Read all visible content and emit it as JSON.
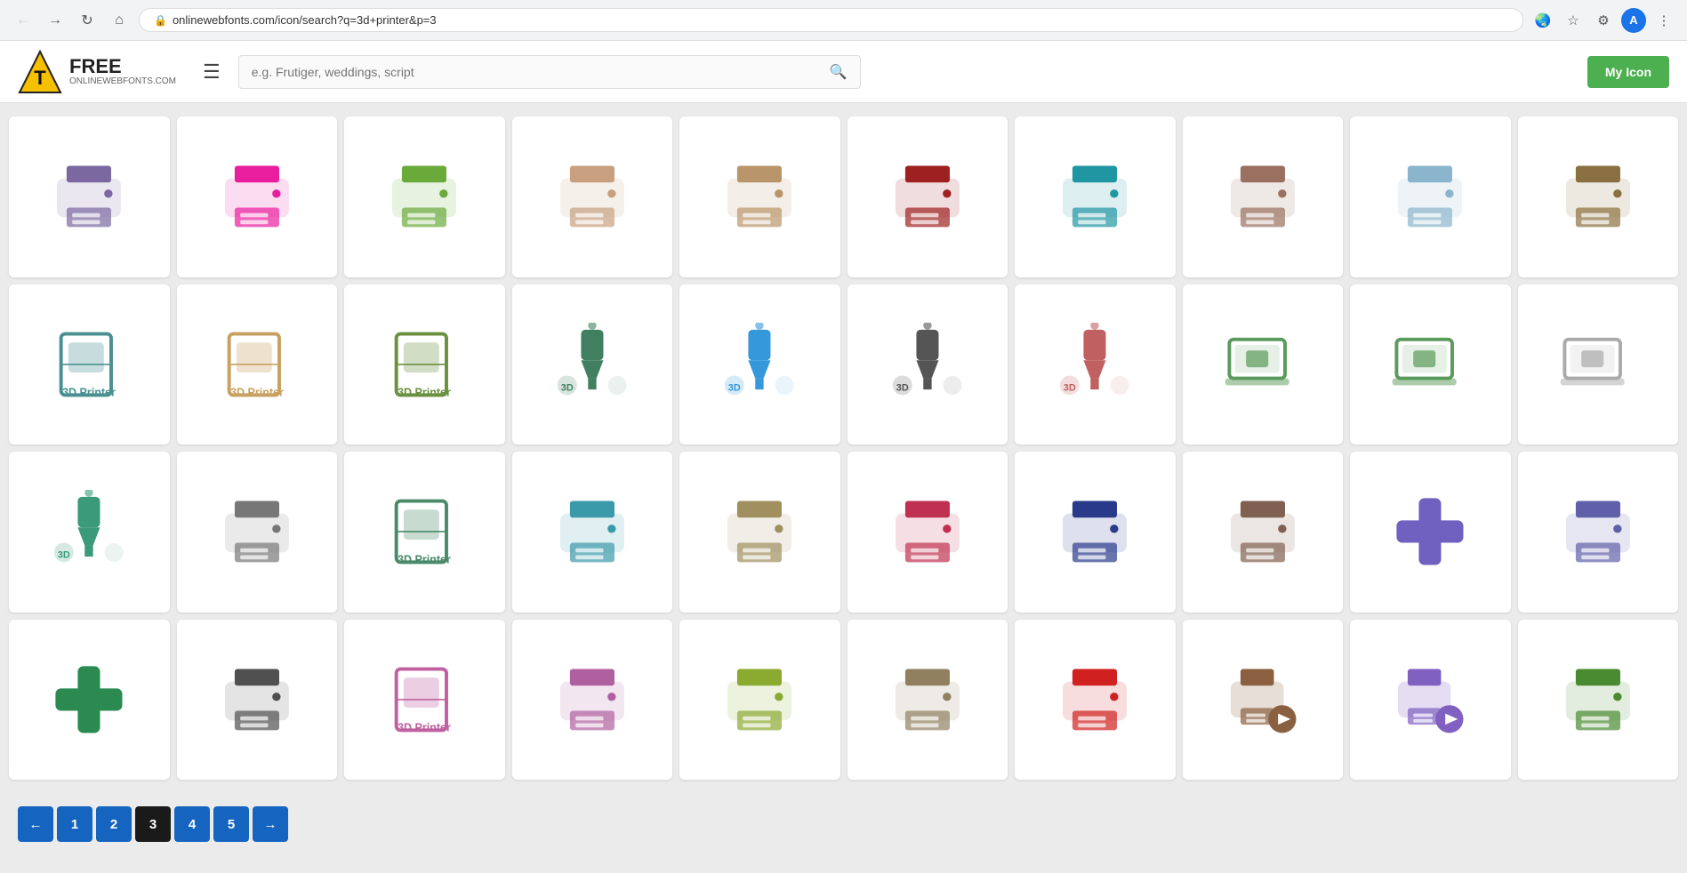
{
  "browser": {
    "url": "onlinewebfonts.com/icon/search?q=3d+printer&p=3",
    "avatar_letter": "A"
  },
  "header": {
    "logo_letter": "T",
    "logo_text": "FREE",
    "logo_sub": "ONLINEWEBFONTS.COM",
    "search_placeholder": "e.g. Frutiger, weddings, script",
    "my_icon_label": "My Icon"
  },
  "pagination": {
    "prev_label": "←",
    "next_label": "→",
    "pages": [
      "1",
      "2",
      "3",
      "4",
      "5"
    ],
    "active_page": "3"
  },
  "icons": [
    {
      "id": "r1c1",
      "color": "#7b68a0",
      "desc": "printer-purple-outline"
    },
    {
      "id": "r1c2",
      "color": "#e91e9e",
      "desc": "printer-pink"
    },
    {
      "id": "r1c3",
      "color": "#6aaa3a",
      "desc": "printer-green"
    },
    {
      "id": "r1c4",
      "color": "#c8a080",
      "desc": "printer-tan-outline"
    },
    {
      "id": "r1c5",
      "color": "#b8956a",
      "desc": "printer-brown-outline"
    },
    {
      "id": "r1c6",
      "color": "#9e2020",
      "desc": "printer-dark-red-circle"
    },
    {
      "id": "r1c7",
      "color": "#2196a3",
      "desc": "printer-teal"
    },
    {
      "id": "r1c8",
      "color": "#9a7060",
      "desc": "printer-taupe"
    },
    {
      "id": "r1c9",
      "color": "#8ab5cc",
      "desc": "printer-blue-light"
    },
    {
      "id": "r1c10",
      "color": "#8a7040",
      "desc": "printer-khaki"
    },
    {
      "id": "r2c1",
      "color": "#4a9090",
      "desc": "3d-box-teal"
    },
    {
      "id": "r2c2",
      "color": "#c8a060",
      "desc": "3d-box-tan"
    },
    {
      "id": "r2c3",
      "color": "#6a9040",
      "desc": "3d-box-green"
    },
    {
      "id": "r2c4",
      "color": "#408060",
      "desc": "3d-printer-car-teal"
    },
    {
      "id": "r2c5",
      "color": "#3498db",
      "desc": "3d-printer-nozzle-blue"
    },
    {
      "id": "r2c6",
      "color": "#555",
      "desc": "3d-printer-nozzle-dark"
    },
    {
      "id": "r2c7",
      "color": "#c06060",
      "desc": "3d-printer-nozzle-pink"
    },
    {
      "id": "r2c8",
      "color": "#5a9a5a",
      "desc": "laptop-3d-green"
    },
    {
      "id": "r2c9",
      "color": "#5a9a5a",
      "desc": "laptop-3d-green2"
    },
    {
      "id": "r2c10",
      "color": "#aaa",
      "desc": "laptop-3d-gray"
    },
    {
      "id": "r3c1",
      "color": "#3a9a7a",
      "desc": "3d-printer-teal"
    },
    {
      "id": "r3c2",
      "color": "#777",
      "desc": "3d-person-gray"
    },
    {
      "id": "r3c3",
      "color": "#4a8a6a",
      "desc": "3d-files-green"
    },
    {
      "id": "r3c4",
      "color": "#3a9aaa",
      "desc": "printer-teal-bold"
    },
    {
      "id": "r3c5",
      "color": "#a09060",
      "desc": "printer-tan"
    },
    {
      "id": "r3c6",
      "color": "#c03050",
      "desc": "printer-red"
    },
    {
      "id": "r3c7",
      "color": "#2a3a8a",
      "desc": "printer-navy"
    },
    {
      "id": "r3c8",
      "color": "#806050",
      "desc": "printer-brown"
    },
    {
      "id": "r3c9",
      "color": "#7060c0",
      "desc": "cross-purple"
    },
    {
      "id": "r3c10",
      "color": "#6060aa",
      "desc": "printer-3d-purple"
    },
    {
      "id": "r4c1",
      "color": "#2a8a50",
      "desc": "cross-green"
    },
    {
      "id": "r4c2",
      "color": "#505050",
      "desc": "printer-dark"
    },
    {
      "id": "r4c3",
      "color": "#c060a0",
      "desc": "3d-printer-pink"
    },
    {
      "id": "r4c4",
      "color": "#b060a0",
      "desc": "printer-pink2"
    },
    {
      "id": "r4c5",
      "color": "#8aaa30",
      "desc": "printer-lime"
    },
    {
      "id": "r4c6",
      "color": "#908060",
      "desc": "printer-tan-small"
    },
    {
      "id": "r4c7",
      "color": "#d02020",
      "desc": "printer-red2"
    },
    {
      "id": "r4c8",
      "color": "#8a6040",
      "desc": "printer-brown-play"
    },
    {
      "id": "r4c9",
      "color": "#8060c0",
      "desc": "printer-purple-play"
    },
    {
      "id": "r4c10",
      "color": "#4a8a30",
      "desc": "printer-green2"
    }
  ]
}
